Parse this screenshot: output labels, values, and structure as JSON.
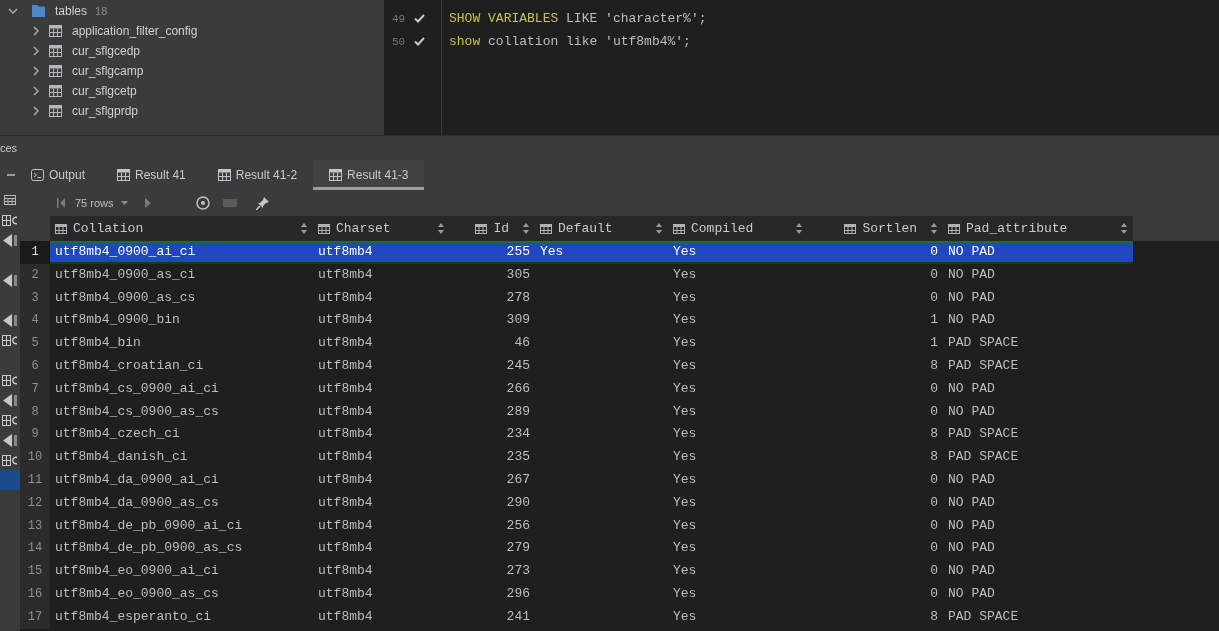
{
  "tree": {
    "label": "tables",
    "count": "18",
    "expanded": true,
    "children": [
      {
        "label": "application_filter_config",
        "expanded": false
      },
      {
        "label": "cur_sflgcedp",
        "expanded": false
      },
      {
        "label": "cur_sflgcamp",
        "expanded": false
      },
      {
        "label": "cur_sflgcetp",
        "expanded": false
      },
      {
        "label": "cur_sflgprdp",
        "expanded": false
      }
    ]
  },
  "editor": {
    "lines": [
      {
        "number": "49",
        "executed": true,
        "tokens": [
          {
            "text": "SHOW",
            "kind": "keyword"
          },
          {
            "text": "VARIABLES",
            "kind": "keyword"
          },
          {
            "text": "LIKE",
            "kind": "plain"
          },
          {
            "text": "'character%';",
            "kind": "plain"
          }
        ]
      },
      {
        "number": "50",
        "executed": true,
        "tokens": [
          {
            "text": "show",
            "kind": "keyword"
          },
          {
            "text": "collation",
            "kind": "plain"
          },
          {
            "text": "like",
            "kind": "plain"
          },
          {
            "text": "'utf8mb4%';",
            "kind": "plain"
          }
        ]
      }
    ]
  },
  "services_panel": {
    "title": "ces"
  },
  "tabs": [
    {
      "label": "Output",
      "kind": "output",
      "selected": false
    },
    {
      "label": "Result 41",
      "kind": "result",
      "selected": false
    },
    {
      "label": "Result 41-2",
      "kind": "result",
      "selected": false
    },
    {
      "label": "Result 41-3",
      "kind": "result",
      "selected": true
    }
  ],
  "tool_strip": [
    {
      "kind": "table",
      "selected": false
    },
    {
      "kind": "server",
      "selected": false
    },
    {
      "kind": "triangle",
      "selected": false
    },
    {
      "kind": "blank",
      "selected": false
    },
    {
      "kind": "triangle",
      "selected": false
    },
    {
      "kind": "blank",
      "selected": false
    },
    {
      "kind": "triangle",
      "selected": false
    },
    {
      "kind": "server",
      "selected": false
    },
    {
      "kind": "blank",
      "selected": false
    },
    {
      "kind": "server",
      "selected": false
    },
    {
      "kind": "triangle",
      "selected": false
    },
    {
      "kind": "server",
      "selected": false
    },
    {
      "kind": "triangle",
      "selected": false
    },
    {
      "kind": "server",
      "selected": false
    },
    {
      "kind": "blank",
      "selected": true
    }
  ],
  "toolbar": {
    "row_count": "75 rows"
  },
  "table": {
    "columns": [
      "Collation",
      "Charset",
      "Id",
      "Default",
      "Compiled",
      "Sortlen",
      "Pad_attribute"
    ],
    "rows": [
      {
        "number": "1",
        "selected": true,
        "collation": "utf8mb4_0900_ai_ci",
        "charset": "utf8mb4",
        "id": "255",
        "default": "Yes",
        "compiled": "Yes",
        "sortlen": "0",
        "pad_attribute": "NO PAD"
      },
      {
        "number": "2",
        "selected": false,
        "collation": "utf8mb4_0900_as_ci",
        "charset": "utf8mb4",
        "id": "305",
        "compiled": "Yes",
        "sortlen": "0",
        "pad_attribute": "NO PAD"
      },
      {
        "number": "3",
        "selected": false,
        "collation": "utf8mb4_0900_as_cs",
        "charset": "utf8mb4",
        "id": "278",
        "compiled": "Yes",
        "sortlen": "0",
        "pad_attribute": "NO PAD"
      },
      {
        "number": "4",
        "selected": false,
        "collation": "utf8mb4_0900_bin",
        "charset": "utf8mb4",
        "id": "309",
        "compiled": "Yes",
        "sortlen": "1",
        "pad_attribute": "NO PAD"
      },
      {
        "number": "5",
        "selected": false,
        "collation": "utf8mb4_bin",
        "charset": "utf8mb4",
        "id": "46",
        "compiled": "Yes",
        "sortlen": "1",
        "pad_attribute": "PAD SPACE"
      },
      {
        "number": "6",
        "selected": false,
        "collation": "utf8mb4_croatian_ci",
        "charset": "utf8mb4",
        "id": "245",
        "compiled": "Yes",
        "sortlen": "8",
        "pad_attribute": "PAD SPACE"
      },
      {
        "number": "7",
        "selected": false,
        "collation": "utf8mb4_cs_0900_ai_ci",
        "charset": "utf8mb4",
        "id": "266",
        "compiled": "Yes",
        "sortlen": "0",
        "pad_attribute": "NO PAD"
      },
      {
        "number": "8",
        "selected": false,
        "collation": "utf8mb4_cs_0900_as_cs",
        "charset": "utf8mb4",
        "id": "289",
        "compiled": "Yes",
        "sortlen": "0",
        "pad_attribute": "NO PAD"
      },
      {
        "number": "9",
        "selected": false,
        "collation": "utf8mb4_czech_ci",
        "charset": "utf8mb4",
        "id": "234",
        "compiled": "Yes",
        "sortlen": "8",
        "pad_attribute": "PAD SPACE"
      },
      {
        "number": "10",
        "selected": false,
        "collation": "utf8mb4_danish_ci",
        "charset": "utf8mb4",
        "id": "235",
        "compiled": "Yes",
        "sortlen": "8",
        "pad_attribute": "PAD SPACE"
      },
      {
        "number": "11",
        "selected": false,
        "collation": "utf8mb4_da_0900_ai_ci",
        "charset": "utf8mb4",
        "id": "267",
        "compiled": "Yes",
        "sortlen": "0",
        "pad_attribute": "NO PAD"
      },
      {
        "number": "12",
        "selected": false,
        "collation": "utf8mb4_da_0900_as_cs",
        "charset": "utf8mb4",
        "id": "290",
        "compiled": "Yes",
        "sortlen": "0",
        "pad_attribute": "NO PAD"
      },
      {
        "number": "13",
        "selected": false,
        "collation": "utf8mb4_de_pb_0900_ai_ci",
        "charset": "utf8mb4",
        "id": "256",
        "compiled": "Yes",
        "sortlen": "0",
        "pad_attribute": "NO PAD"
      },
      {
        "number": "14",
        "selected": false,
        "collation": "utf8mb4_de_pb_0900_as_cs",
        "charset": "utf8mb4",
        "id": "279",
        "compiled": "Yes",
        "sortlen": "0",
        "pad_attribute": "NO PAD"
      },
      {
        "number": "15",
        "selected": false,
        "collation": "utf8mb4_eo_0900_ai_ci",
        "charset": "utf8mb4",
        "id": "273",
        "compiled": "Yes",
        "sortlen": "0",
        "pad_attribute": "NO PAD"
      },
      {
        "number": "16",
        "selected": false,
        "collation": "utf8mb4_eo_0900_as_cs",
        "charset": "utf8mb4",
        "id": "296",
        "compiled": "Yes",
        "sortlen": "0",
        "pad_attribute": "NO PAD"
      },
      {
        "number": "17",
        "selected": false,
        "collation": "utf8mb4_esperanto_ci",
        "charset": "utf8mb4",
        "id": "241",
        "compiled": "Yes",
        "sortlen": "8",
        "pad_attribute": "PAD SPACE"
      }
    ]
  }
}
